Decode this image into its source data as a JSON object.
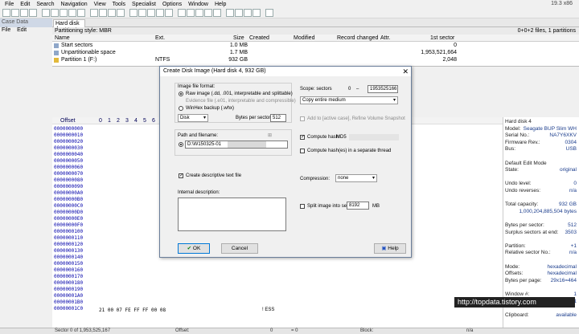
{
  "menu": [
    "File",
    "Edit",
    "Search",
    "Navigation",
    "View",
    "Tools",
    "Specialist",
    "Options",
    "Window",
    "Help"
  ],
  "version": "19.3 x86",
  "case_panel": {
    "title": "Case Data",
    "menu": [
      "File",
      "Edit"
    ]
  },
  "tab": "Hard disk 4",
  "partitioning": "Partitioning style: MBR",
  "summary": "0+0+2 files, 1 partitions",
  "columns": [
    "Name",
    "Ext.",
    "Size",
    "Created",
    "Modified",
    "Record changed",
    "Attr.",
    "1st sector"
  ],
  "files": [
    {
      "name": "Start sectors",
      "ext": "",
      "size": "1.0 MB",
      "sector": "0"
    },
    {
      "name": "Unpartitionable space",
      "ext": "",
      "size": "1.7 MB",
      "sector": "1,953,521,664"
    },
    {
      "name": "Partition 1 (F:)",
      "ext": "NTFS",
      "size": "932 GB",
      "sector": "2,048"
    }
  ],
  "hex": {
    "header": "Offset",
    "cols": [
      "0",
      "1",
      "2",
      "3",
      "4",
      "5",
      "6",
      "7"
    ],
    "offsets": [
      "0000000000",
      "0000000010",
      "0000000020",
      "0000000030",
      "0000000040",
      "0000000050",
      "0000000060",
      "0000000070",
      "0000000080",
      "0000000090",
      "00000000A0",
      "00000000B0",
      "00000000C0",
      "00000000D0",
      "00000000E0",
      "00000000F0",
      "0000000100",
      "0000000110",
      "0000000120",
      "0000000130",
      "0000000140",
      "0000000150",
      "0000000160",
      "0000000170",
      "0000000180",
      "0000000190",
      "00000001A0",
      "00000001B0",
      "00000001C0"
    ],
    "last_row_bytes": "21 00 07 FE FF FF 00 08",
    "ascii": "! ESS"
  },
  "info": [
    {
      "l": "Hard disk 4",
      "v": ""
    },
    {
      "l": "Model:",
      "v": "Seagate BUP Slim WH"
    },
    {
      "l": "Serial No.:",
      "v": "NA7Y6XKV"
    },
    {
      "l": "Firmware Rev.:",
      "v": "0304"
    },
    {
      "l": "Bus:",
      "v": "USB"
    },
    {
      "l": "",
      "v": ""
    },
    {
      "l": "Default Edit Mode",
      "v": ""
    },
    {
      "l": "State:",
      "v": "original"
    },
    {
      "l": "",
      "v": ""
    },
    {
      "l": "Undo level:",
      "v": "0"
    },
    {
      "l": "Undo reverses:",
      "v": "n/a"
    },
    {
      "l": "",
      "v": ""
    },
    {
      "l": "Total capacity:",
      "v": "932 GB"
    },
    {
      "l": "",
      "v": "1,000,204,885,504 bytes"
    },
    {
      "l": "",
      "v": ""
    },
    {
      "l": "Bytes per sector:",
      "v": "512"
    },
    {
      "l": "Surplus sectors at end:",
      "v": "3503"
    },
    {
      "l": "",
      "v": ""
    },
    {
      "l": "Partition:",
      "v": "+1"
    },
    {
      "l": "Relative sector No.:",
      "v": "n/a"
    },
    {
      "l": "",
      "v": ""
    },
    {
      "l": "Mode:",
      "v": "hexadecimal"
    },
    {
      "l": "Offsets:",
      "v": "hexadecimal"
    },
    {
      "l": "Bytes per page:",
      "v": "29x16=464"
    },
    {
      "l": "",
      "v": ""
    },
    {
      "l": "Window #:",
      "v": "1"
    },
    {
      "l": "No. of windows:",
      "v": "1"
    },
    {
      "l": "",
      "v": ""
    },
    {
      "l": "Clipboard:",
      "v": "available"
    }
  ],
  "status": {
    "sector": "Sector 0 of 1,953,525,167",
    "offset": "Offset:",
    "offset_val": "0",
    "eq": "= 0",
    "block": "Block:",
    "block_val": "n/a"
  },
  "watermark": "http://topdata.tistory.com",
  "dialog": {
    "title": "Create Disk Image (Hard disk 4, 932 GB)",
    "format_label": "Image file format:",
    "raw": "Raw image (.dd, .001, interpretable and splittable)",
    "evidence": "Evidence file (.e01, interpretable and compressible)",
    "winhex": "WinHex backup (.whx)",
    "disk_sel": "Disk",
    "bytes_per_sector_label": "Bytes per sector:",
    "bytes_per_sector": "512",
    "path_label": "Path and filename:",
    "path_value": "D:\\W150325-01",
    "descriptive": "Create descriptive text file",
    "internal_desc": "Internal description:",
    "scope_label": "Scope: sectors",
    "scope_from": "0",
    "scope_to": "1953525166",
    "copy_mode": "Copy entire medium",
    "add_case": "Add to [active case], Refine Volume Snapshot",
    "compute_hash": "Compute hash:",
    "hash_alg": "MD5",
    "compute_hash_sep": "Compute hash(es) in a separate thread",
    "compression_label": "Compression:",
    "compression": "none",
    "split_label": "Split image into segments of",
    "split_value": "8192",
    "split_unit": "MB",
    "ok": "OK",
    "cancel": "Cancel",
    "help": "Help"
  }
}
